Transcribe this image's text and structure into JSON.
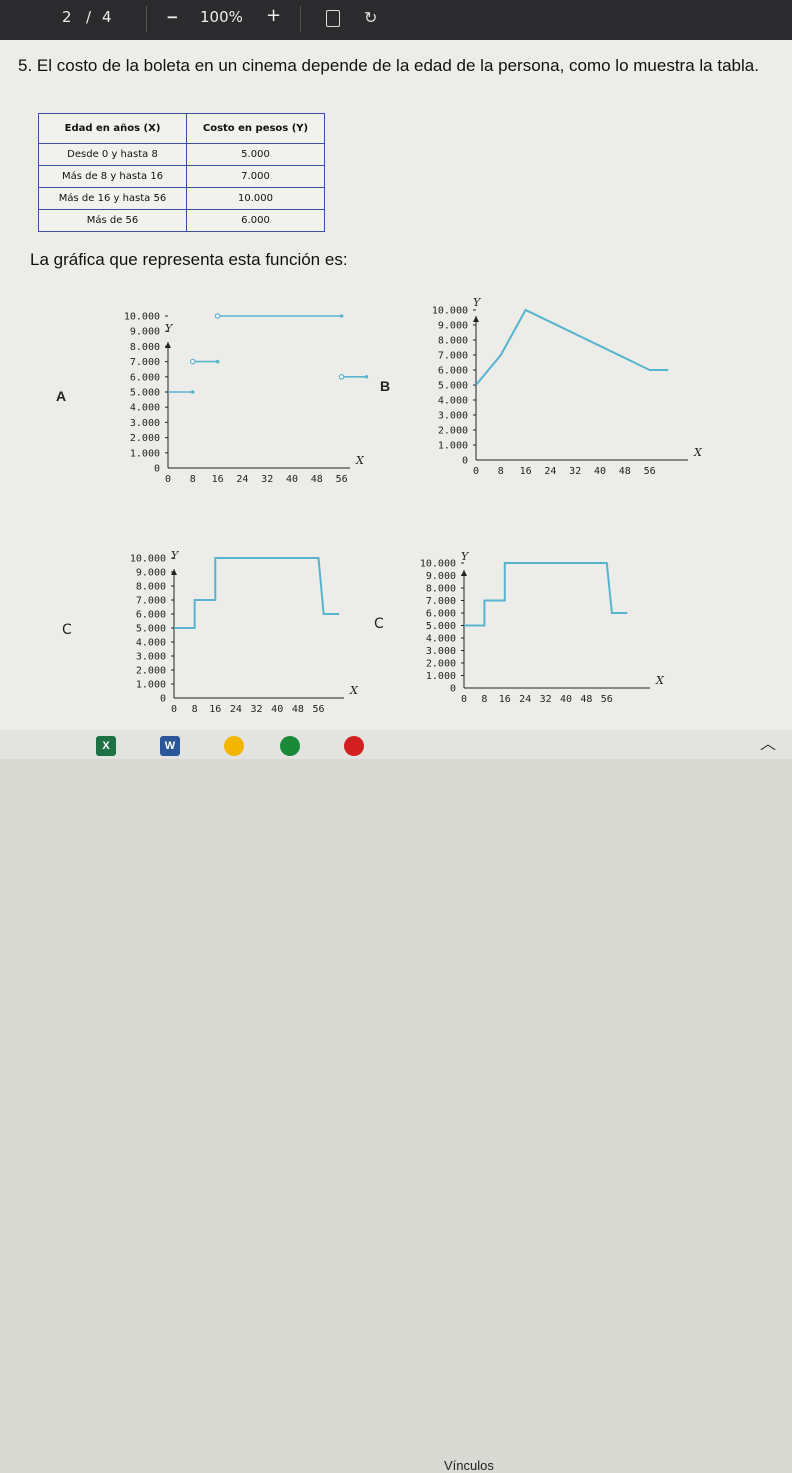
{
  "viewer": {
    "page_current": "2",
    "page_sep": "/",
    "page_total": "4",
    "zoom_minus": "−",
    "zoom": "100%",
    "zoom_plus": "+"
  },
  "question": {
    "text": "5. El costo de la boleta en un cinema depende de la edad de la persona, como lo muestra la tabla."
  },
  "table": {
    "headers": [
      "Edad en años (X)",
      "Costo en pesos (Y)"
    ],
    "rows": [
      [
        "Desde 0 y hasta 8",
        "5.000"
      ],
      [
        "Más de 8 y hasta 16",
        "7.000"
      ],
      [
        "Más de 16 y hasta 56",
        "10.000"
      ],
      [
        "Más de 56",
        "6.000"
      ]
    ]
  },
  "lead": "La gráfica que representa esta función es:",
  "chart_data": [
    {
      "option": "A",
      "type": "line",
      "xlabel": "X",
      "ylabel": "Y",
      "x_ticks": [
        "0",
        "8",
        "16",
        "24",
        "32",
        "40",
        "48",
        "56"
      ],
      "y_ticks": [
        "0",
        "1.000",
        "2.000",
        "3.000",
        "4.000",
        "5.000",
        "6.000",
        "7.000",
        "8.000",
        "9.000",
        "10.000"
      ],
      "segments": [
        {
          "x": [
            0,
            8
          ],
          "y": [
            5000,
            5000
          ]
        },
        {
          "x": [
            8,
            16
          ],
          "y": [
            7000,
            7000
          ]
        },
        {
          "x": [
            16,
            56
          ],
          "y": [
            10000,
            10000
          ]
        },
        {
          "x": [
            56,
            64
          ],
          "y": [
            6000,
            6000
          ]
        }
      ]
    },
    {
      "option": "B",
      "type": "line",
      "xlabel": "X",
      "ylabel": "Y",
      "x_ticks": [
        "0",
        "8",
        "16",
        "24",
        "32",
        "40",
        "48",
        "56"
      ],
      "y_ticks": [
        "0",
        "1.000",
        "2.000",
        "3.000",
        "4.000",
        "5.000",
        "6.000",
        "7.000",
        "8.000",
        "9.000",
        "10.000"
      ],
      "segments": [
        {
          "x": [
            0,
            8,
            16,
            56,
            62
          ],
          "y": [
            5000,
            7000,
            10000,
            6000,
            6000
          ]
        }
      ]
    },
    {
      "option": "C",
      "type": "line",
      "xlabel": "X",
      "ylabel": "Y",
      "x_ticks": [
        "0",
        "8",
        "16",
        "24",
        "32",
        "40",
        "48",
        "56"
      ],
      "y_ticks": [
        "0",
        "1.000",
        "2.000",
        "3.000",
        "4.000",
        "5.000",
        "6.000",
        "7.000",
        "8.000",
        "9.000",
        "10.000"
      ],
      "segments": [
        {
          "x": [
            0,
            8,
            8,
            16,
            16,
            56,
            58,
            64
          ],
          "y": [
            5000,
            5000,
            7000,
            7000,
            10000,
            10000,
            6000,
            6000
          ]
        }
      ]
    },
    {
      "option": "C",
      "type": "line",
      "xlabel": "X",
      "ylabel": "Y",
      "x_ticks": [
        "0",
        "8",
        "16",
        "24",
        "32",
        "40",
        "48",
        "56"
      ],
      "y_ticks": [
        "0",
        "1.000",
        "2.000",
        "3.000",
        "4.000",
        "5.000",
        "6.000",
        "7.000",
        "8.000",
        "9.000",
        "10.000"
      ],
      "segments": [
        {
          "x": [
            0,
            8,
            8,
            16,
            16,
            56,
            58,
            64
          ],
          "y": [
            5000,
            5000,
            7000,
            7000,
            10000,
            10000,
            6000,
            6000
          ]
        }
      ]
    }
  ],
  "taskbar": {
    "links_label": "Vínculos",
    "excel_letter": "X",
    "word_letter": "W"
  },
  "colors": {
    "line": "#58b3cf",
    "accent_blue": "#3b4fa0",
    "toolbar": "#2b2b2e"
  }
}
